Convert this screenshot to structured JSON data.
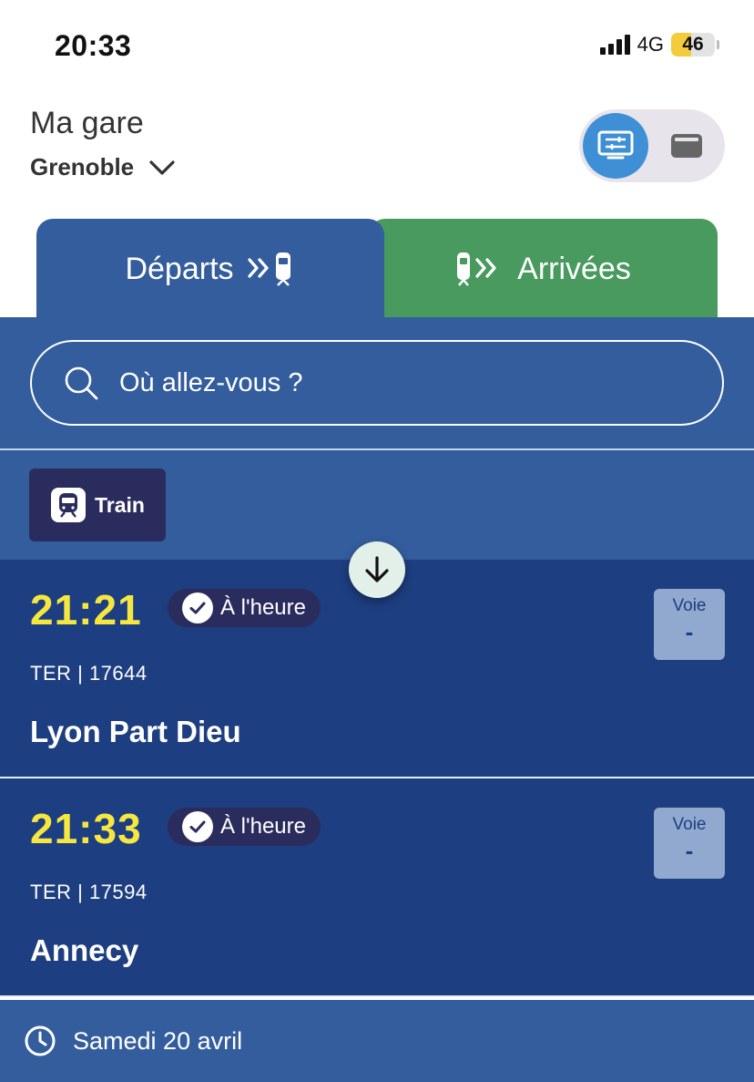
{
  "status_bar": {
    "time": "20:33",
    "network": "4G",
    "battery": "46",
    "battery_level": 0.46
  },
  "header": {
    "label": "Ma gare",
    "station": "Grenoble",
    "view_toggle": {
      "active": "board-icon",
      "inactive": "card-icon"
    }
  },
  "tabs": [
    {
      "label": "Départs",
      "icon": "departure-train-icon",
      "color": "#345d9d",
      "active": true
    },
    {
      "label": "Arrivées",
      "icon": "arrival-train-icon",
      "color": "#489a5e",
      "active": false
    }
  ],
  "search": {
    "placeholder": "Où allez-vous ?"
  },
  "filters": [
    {
      "label": "Train",
      "icon": "train-icon",
      "selected": true
    }
  ],
  "departures": [
    {
      "time": "21:21",
      "status": "À l'heure",
      "train": "TER | 17644",
      "destination": "Lyon Part Dieu",
      "platform_label": "Voie",
      "platform": "-"
    },
    {
      "time": "21:33",
      "status": "À l'heure",
      "train": "TER | 17594",
      "destination": "Annecy",
      "platform_label": "Voie",
      "platform": "-"
    }
  ],
  "footer": {
    "date": "Samedi 20 avril",
    "icon": "clock-icon"
  },
  "colors": {
    "primary": "#345d9d",
    "row": "#1d3e80",
    "arrivals": "#489a5e",
    "time": "#f5e740",
    "badge": "#2b2c5e"
  }
}
